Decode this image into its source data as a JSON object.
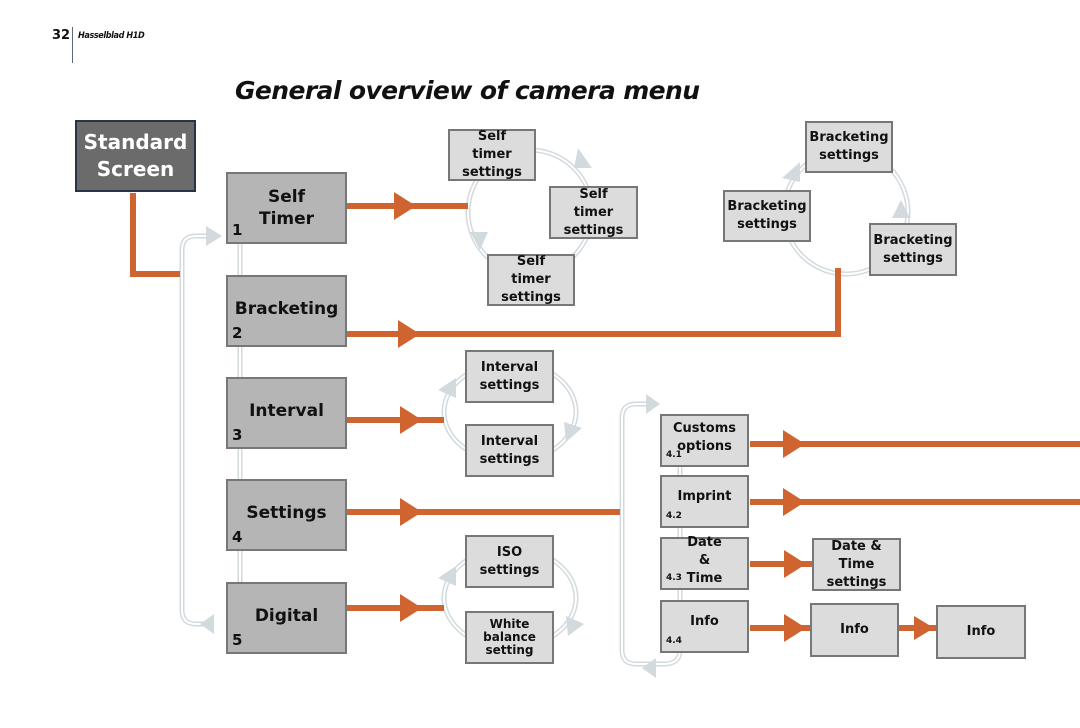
{
  "header": {
    "page_number": "32",
    "book_title": "Hasselblad H1D",
    "main_title": "General overview of camera menu"
  },
  "start": {
    "label": "Standard Screen"
  },
  "menu_items": [
    {
      "label": "Self Timer",
      "number": "1"
    },
    {
      "label": "Bracketing",
      "number": "2"
    },
    {
      "label": "Interval",
      "number": "3"
    },
    {
      "label": "Settings",
      "number": "4"
    },
    {
      "label": "Digital",
      "number": "5"
    }
  ],
  "self_timer_cycle": [
    "Self timer settings",
    "Self timer settings",
    "Self timer settings"
  ],
  "bracketing_cycle": [
    "Bracketing settings",
    "Bracketing settings",
    "Bracketing settings"
  ],
  "interval_cycle": [
    "Interval settings",
    "Interval settings"
  ],
  "digital_cycle": [
    "ISO settings",
    "White balance setting"
  ],
  "settings_submenu": [
    {
      "label": "Customs options",
      "number": "4.1"
    },
    {
      "label": "Imprint",
      "number": "4.2"
    },
    {
      "label": "Date & Time",
      "number": "4.3"
    },
    {
      "label": "Info",
      "number": "4.4"
    }
  ],
  "date_time_target": "Date & Time settings",
  "info_targets": [
    "Info",
    "Info"
  ],
  "colors": {
    "connector_orange": "#cf6430",
    "cycle_arrow_gray": "#d0d8dd",
    "menu_box_fill": "#b5b5b5",
    "sub_box_fill": "#dcdcdc",
    "start_box_fill": "#6b6b6b"
  }
}
